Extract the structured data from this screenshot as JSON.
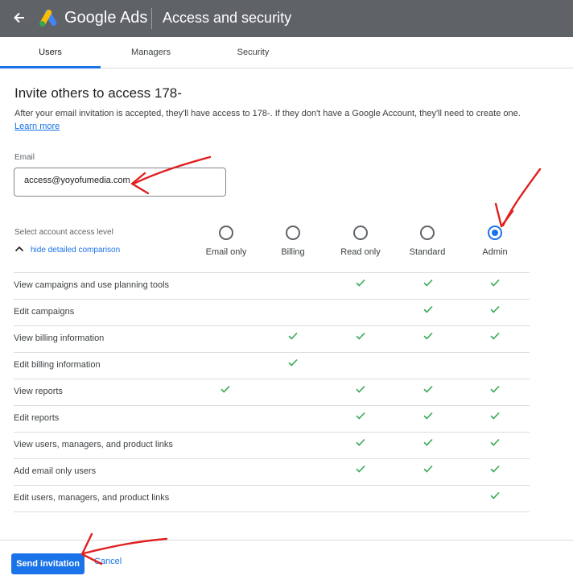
{
  "header": {
    "app_name": "Google Ads",
    "page_title": "Access and security",
    "back_icon": "arrow-back-icon",
    "logo_icon": "google-ads-logo",
    "bg_color": "#5f6368"
  },
  "tabs": [
    {
      "label": "Users",
      "active": true
    },
    {
      "label": "Managers",
      "active": false
    },
    {
      "label": "Security",
      "active": false
    }
  ],
  "invite": {
    "heading": "Invite others to access 178-",
    "description_lead": "After your email invitation is accepted, they'll have access to 178-",
    "description_tail": ". If they don't have a Google Account, they'll need to create one.",
    "learn_more": "Learn more"
  },
  "email": {
    "label": "Email",
    "value": "access@yoyofumedia.com"
  },
  "access": {
    "label": "Select account access level",
    "toggle_label": "hide detailed comparison",
    "toggle_icon": "chevron-up-icon",
    "levels": [
      {
        "label": "Email only",
        "selected": false
      },
      {
        "label": "Billing",
        "selected": false
      },
      {
        "label": "Read only",
        "selected": false
      },
      {
        "label": "Standard",
        "selected": false
      },
      {
        "label": "Admin",
        "selected": true
      }
    ]
  },
  "comparison": {
    "check_icon": "check-icon",
    "check_color": "#34a853",
    "rows": [
      {
        "label": "View campaigns and use planning tools",
        "checks": [
          false,
          false,
          true,
          true,
          true
        ]
      },
      {
        "label": "Edit campaigns",
        "checks": [
          false,
          false,
          false,
          true,
          true
        ]
      },
      {
        "label": "View billing information",
        "checks": [
          false,
          true,
          true,
          true,
          true
        ]
      },
      {
        "label": "Edit billing information",
        "checks": [
          false,
          true,
          false,
          false,
          false
        ]
      },
      {
        "label": "View reports",
        "checks": [
          true,
          false,
          true,
          true,
          true
        ]
      },
      {
        "label": "Edit reports",
        "checks": [
          false,
          false,
          true,
          true,
          true
        ]
      },
      {
        "label": "View users, managers, and product links",
        "checks": [
          false,
          false,
          true,
          true,
          true
        ]
      },
      {
        "label": "Add email only users",
        "checks": [
          false,
          false,
          true,
          true,
          true
        ]
      },
      {
        "label": "Edit users, managers, and product links",
        "checks": [
          false,
          false,
          false,
          false,
          true
        ]
      }
    ]
  },
  "footer": {
    "send_label": "Send invitation",
    "cancel_label": "Cancel",
    "accent_color": "#1a73e8"
  },
  "annotations": {
    "arrow_color": "#e02020"
  }
}
